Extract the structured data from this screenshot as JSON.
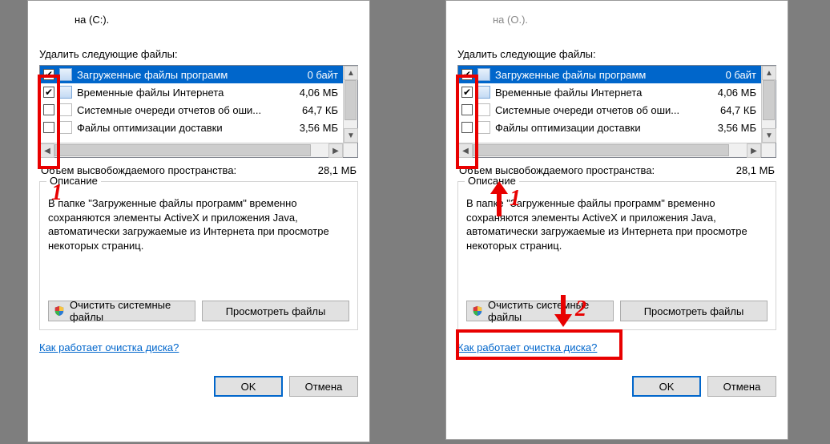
{
  "top_line": "на (C:).",
  "top_line_right": "на (O.).",
  "delete_label": "Удалить следующие файлы:",
  "items": [
    {
      "label": "Загруженные файлы программ",
      "size": "0 байт",
      "checked": true,
      "selected": true
    },
    {
      "label": "Временные файлы Интернета",
      "size": "4,06 МБ",
      "checked": true,
      "selected": false
    },
    {
      "label": "Системные очереди отчетов об оши...",
      "size": "64,7 КБ",
      "checked": false,
      "selected": false
    },
    {
      "label": "Файлы оптимизации доставки",
      "size": "3,56 МБ",
      "checked": false,
      "selected": false
    }
  ],
  "total_label": "Объем высвобождаемого пространства:",
  "total_value": "28,1 МБ",
  "group_title": "Описание",
  "description": "В папке \"Загруженные файлы программ\" временно сохраняются элементы ActiveX и приложения Java, автоматически загружаемые из Интернета при просмотре некоторых страниц.",
  "clean_button": "Очистить системные файлы",
  "view_button": "Просмотреть файлы",
  "link": "Как работает очистка диска?",
  "ok": "OK",
  "cancel": "Отмена",
  "annotations": {
    "one": "1",
    "two": "2"
  }
}
